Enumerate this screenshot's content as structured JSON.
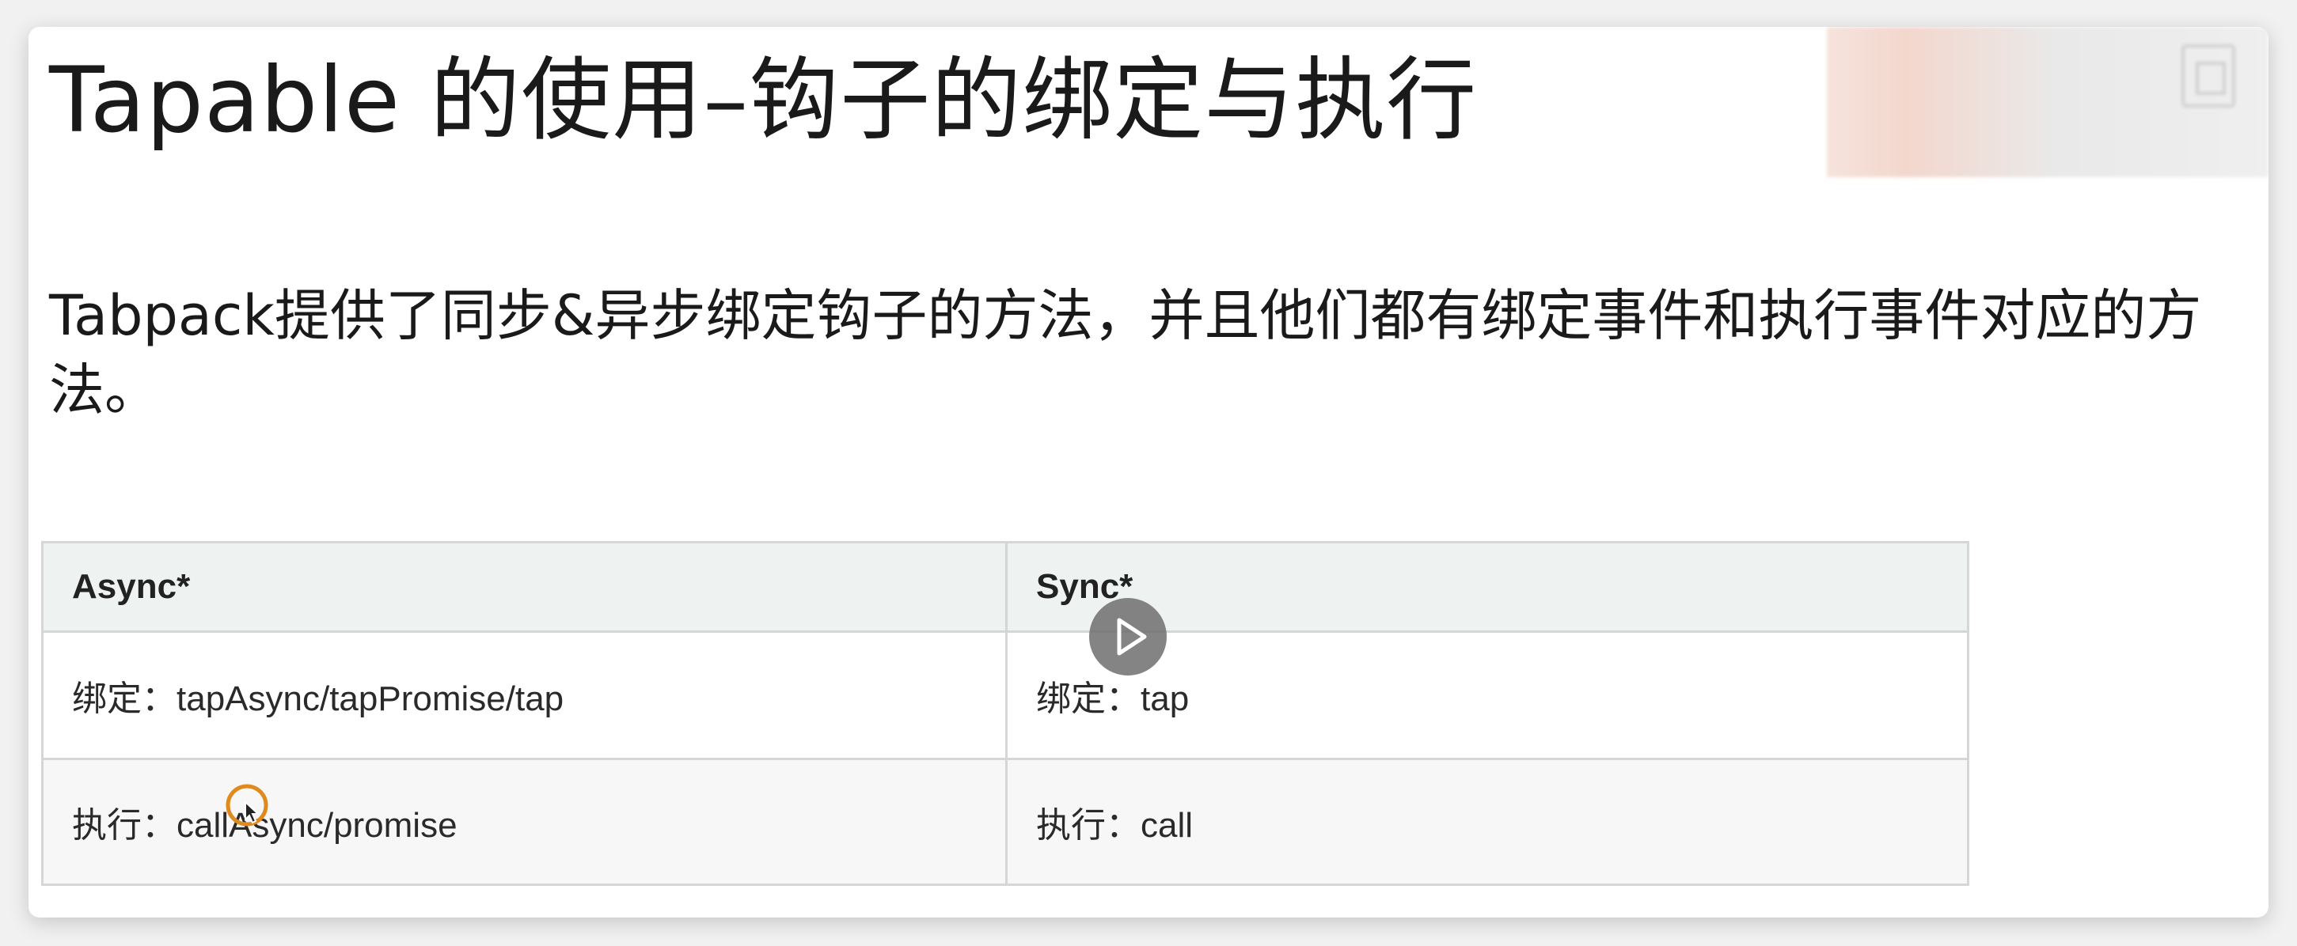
{
  "slide": {
    "title": "Tapable 的使用–钩子的绑定与执行",
    "description": "Tabpack提供了同步&异步绑定钩子的方法，并且他们都有绑定事件和执行事件对应的方法。"
  },
  "table": {
    "headers": [
      "Async*",
      "Sync*"
    ],
    "rows": [
      [
        "绑定：tapAsync/tapPromise/tap",
        "绑定：tap"
      ],
      [
        "执行：callAsync/promise",
        "执行：call"
      ]
    ]
  },
  "player": {
    "play_icon": "play-icon",
    "cursor_icon": "cursor-arrow-icon",
    "accent": "#e08a1e"
  }
}
